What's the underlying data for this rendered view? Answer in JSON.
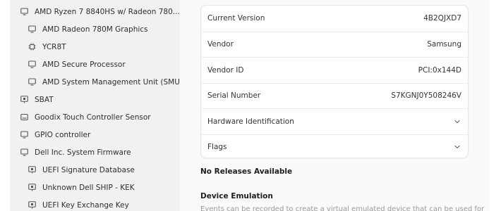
{
  "sidebar": {
    "items": [
      {
        "label": "AMD Ryzen 7 8840HS w/ Radeon 780...",
        "icon": "monitor-icon",
        "level": 1
      },
      {
        "label": "AMD Radeon 780M Graphics",
        "icon": "monitor-icon",
        "level": 2
      },
      {
        "label": "YCR8T",
        "icon": "chip-icon",
        "level": 2
      },
      {
        "label": "AMD Secure Processor",
        "icon": "monitor-icon",
        "level": 2
      },
      {
        "label": "AMD System Management Unit (SMU)",
        "icon": "monitor-icon",
        "level": 2
      },
      {
        "label": "SBAT",
        "icon": "firmware-icon",
        "level": 1
      },
      {
        "label": "Goodix Touch Controller Sensor",
        "icon": "touch-sensor-icon",
        "level": 1
      },
      {
        "label": "GPIO controller",
        "icon": "monitor-icon",
        "level": 1
      },
      {
        "label": "Dell Inc. System Firmware",
        "icon": "monitor-icon",
        "level": 1
      },
      {
        "label": "UEFI Signature Database",
        "icon": "firmware-icon",
        "level": 2
      },
      {
        "label": "Unknown Dell SHIP - KEK",
        "icon": "firmware-icon",
        "level": 2
      },
      {
        "label": "UEFI Key Exchange Key",
        "icon": "firmware-icon",
        "level": 2
      }
    ]
  },
  "details": {
    "rows": [
      {
        "label": "Current Version",
        "value": "4B2QJXD7"
      },
      {
        "label": "Vendor",
        "value": "Samsung"
      },
      {
        "label": "Vendor ID",
        "value": "PCI:0x144D"
      },
      {
        "label": "Serial Number",
        "value": "S7KGNJ0Y508246V"
      }
    ],
    "expanders": [
      {
        "label": "Hardware Identification",
        "icon": "chevron-down-icon"
      },
      {
        "label": "Flags",
        "icon": "chevron-down-icon"
      }
    ]
  },
  "releases": {
    "heading": "No Releases Available"
  },
  "emulation": {
    "heading": "Device Emulation",
    "description": "Events can be recorded to create a virtual emulated device that can be used for"
  },
  "colors": {
    "sidebar_bg": "#f1f1f1",
    "main_bg": "#fafafa",
    "card_bg": "#ffffff",
    "text": "#2e2e2e"
  }
}
